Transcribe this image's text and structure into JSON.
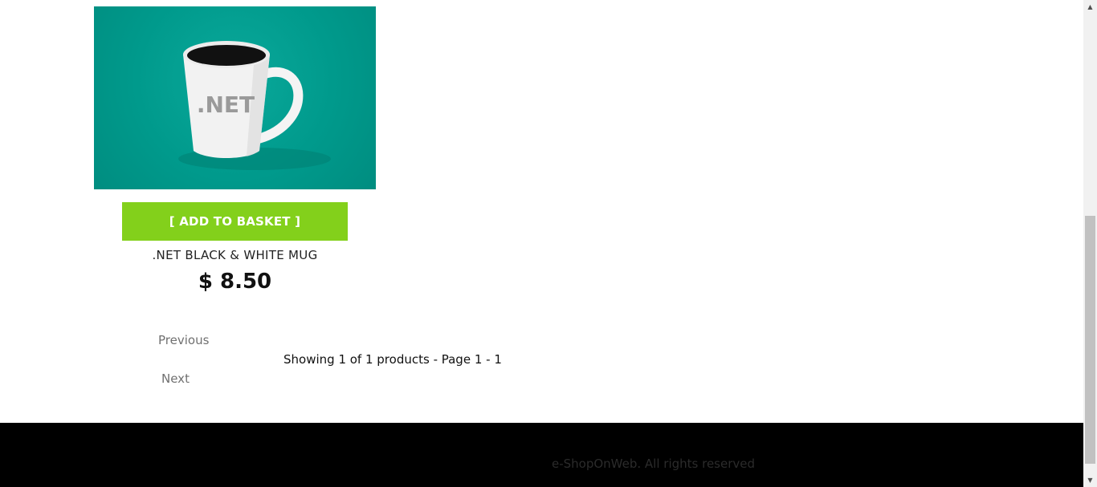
{
  "product": {
    "image_alt": "mug-image",
    "mug_print": ".NET",
    "add_button_label": "[ ADD TO BASKET ]",
    "name": ".NET BLACK & WHITE MUG",
    "price": "$ 8.50"
  },
  "pager": {
    "previous_label": "Previous",
    "next_label": "Next",
    "info": "Showing 1 of 1 products - Page 1 - 1"
  },
  "footer": {
    "text": "e-ShopOnWeb. All rights reserved"
  },
  "colors": {
    "button": "#83d01b",
    "image_background": "#009a8c",
    "footer_background": "#000000"
  },
  "icons": {
    "scroll_up": "triangle-up",
    "scroll_down": "triangle-down"
  }
}
